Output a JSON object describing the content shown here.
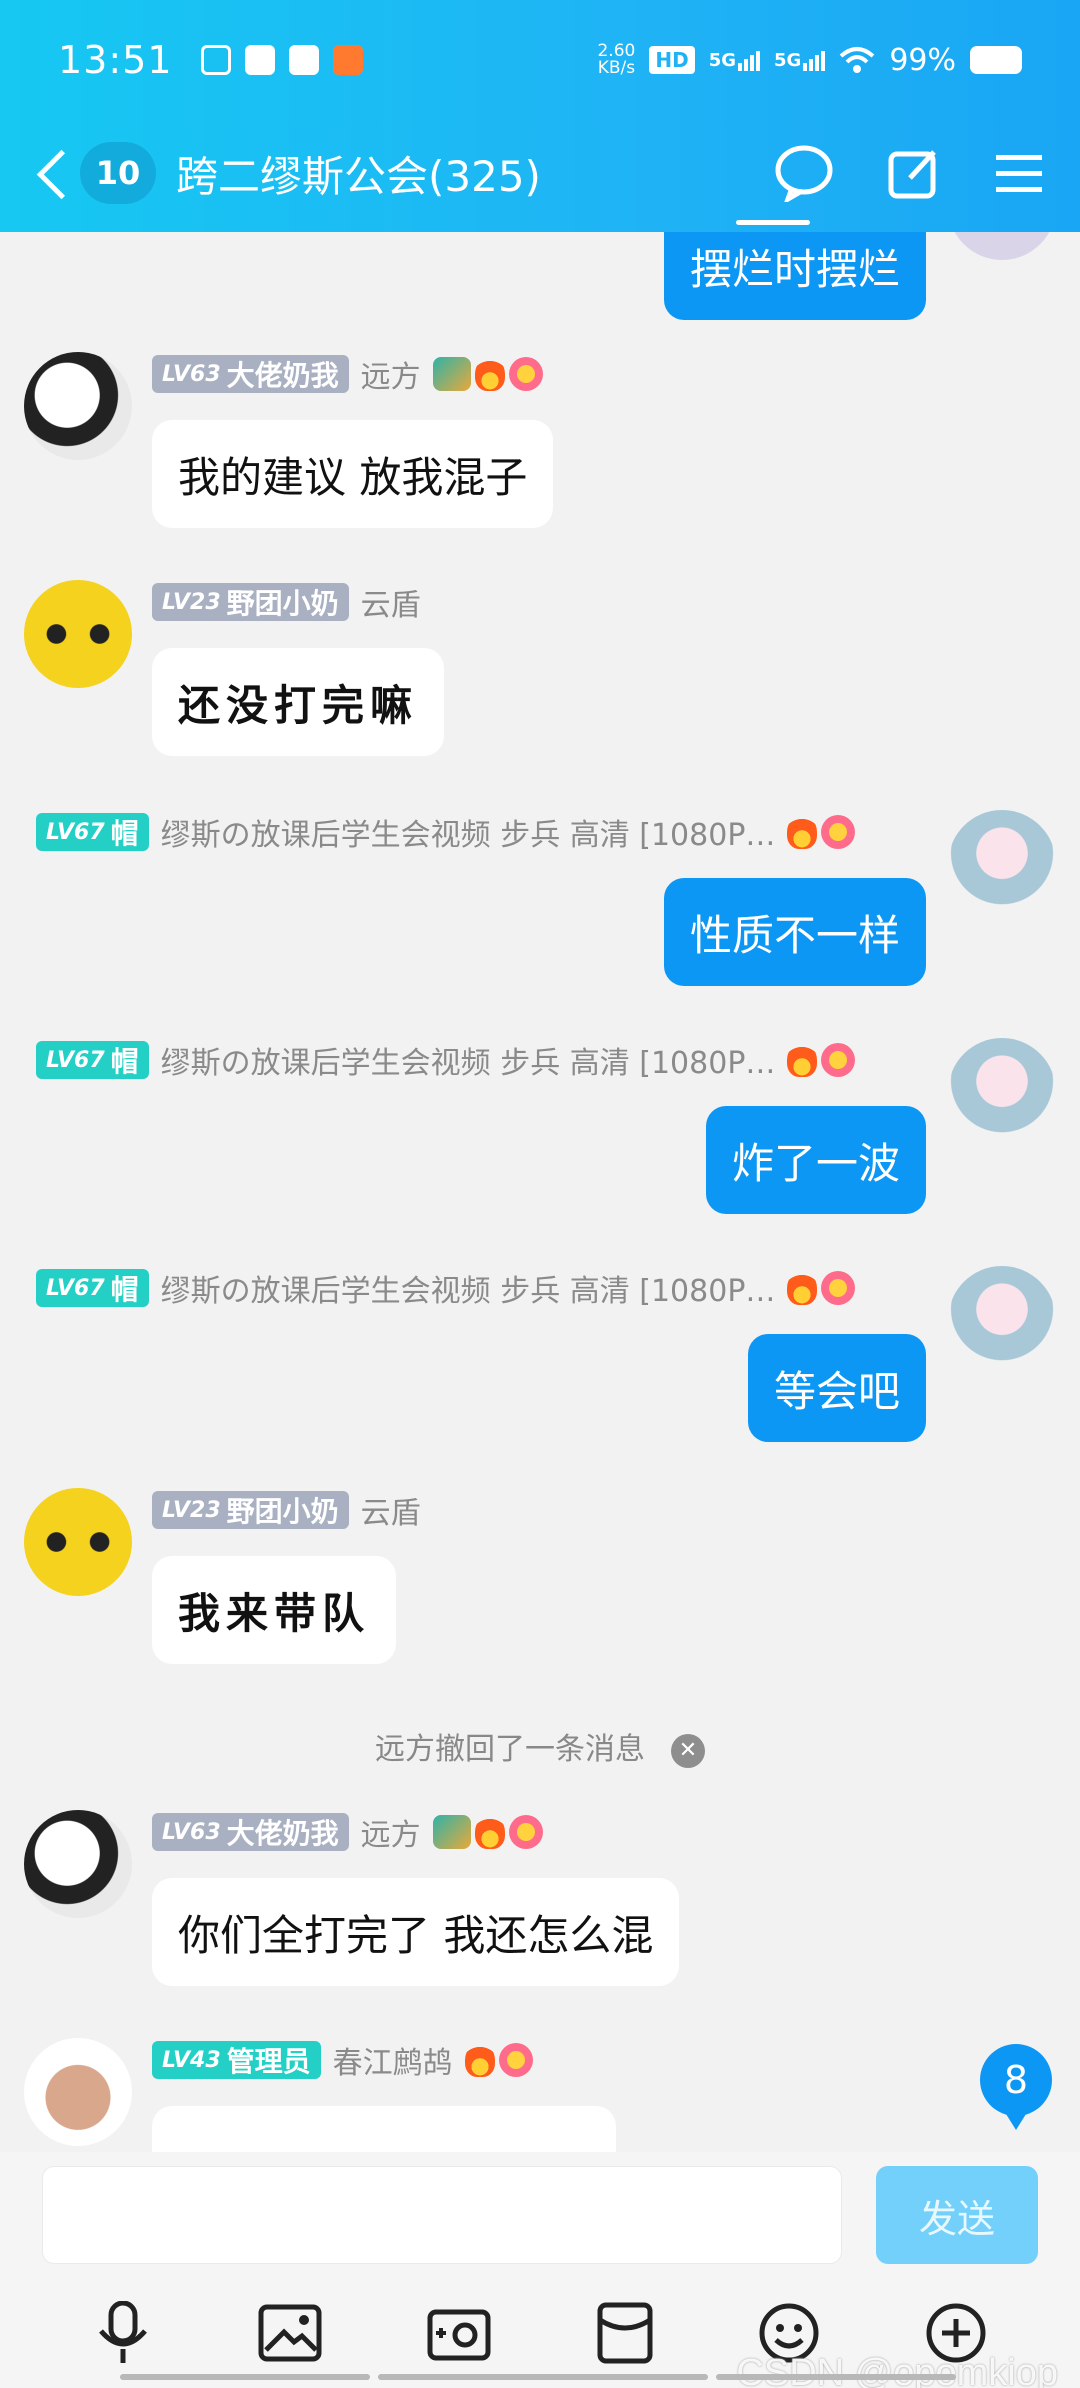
{
  "status_bar": {
    "time": "13:51",
    "net_speed_value": "2.60",
    "net_speed_unit": "KB/s",
    "hd_label": "HD",
    "sim1": "5G",
    "sim2": "5G",
    "battery": "99%"
  },
  "header": {
    "unread_count": "10",
    "group_title": "跨二缪斯公会(325)"
  },
  "messages": [
    {
      "text": "摆烂时摆烂"
    },
    {
      "level": "LV63",
      "title": "大佬奶我",
      "name": "远方",
      "text": "我的建议 放我混子"
    },
    {
      "level": "LV23",
      "title": "野团小奶",
      "name": "云盾",
      "text": "还没打完嘛"
    },
    {
      "level": "LV67",
      "title": "帽",
      "name": "缪斯の放课后学生会视频 步兵 高清 [1080P…",
      "text": "性质不一样"
    },
    {
      "level": "LV67",
      "title": "帽",
      "name": "缪斯の放课后学生会视频 步兵 高清 [1080P…",
      "text": "炸了一波"
    },
    {
      "level": "LV67",
      "title": "帽",
      "name": "缪斯の放课后学生会视频 步兵 高清 [1080P…",
      "text": "等会吧"
    },
    {
      "level": "LV23",
      "title": "野团小奶",
      "name": "云盾",
      "text": "我来带队"
    },
    {
      "level": "LV63",
      "title": "大佬奶我",
      "name": "远方",
      "text": "你们全打完了 我还怎么混"
    },
    {
      "level": "LV43",
      "title": "管理员",
      "name": "春江鹧鸪"
    }
  ],
  "recall_notice": "远方撤回了一条消息",
  "unread_floating": "8",
  "input": {
    "placeholder": "",
    "send_label": "发送"
  },
  "watermark": "CSDN @opomkiop",
  "colors": {
    "header": "#1fb3f5",
    "outgoing_bubble": "#0d97f5",
    "send_button": "#73d0fb"
  },
  "icons": [
    "back-icon",
    "chat-bubble-icon",
    "edit-icon",
    "menu-icon",
    "mic-icon",
    "image-icon",
    "camera-icon",
    "red-packet-icon",
    "emoji-icon",
    "plus-icon"
  ]
}
